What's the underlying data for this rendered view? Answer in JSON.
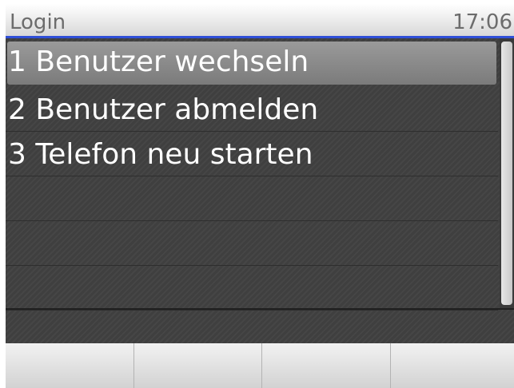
{
  "header": {
    "title": "Login",
    "time": "17:06"
  },
  "menu": {
    "items": [
      {
        "label": "1 Benutzer wechseln",
        "selected": true
      },
      {
        "label": "2 Benutzer abmelden",
        "selected": false
      },
      {
        "label": "3 Telefon neu starten",
        "selected": false
      }
    ]
  },
  "softkeys": [
    "",
    "",
    "",
    ""
  ],
  "colors": {
    "accent": "#2f4fd8",
    "background": "#3f3f3f",
    "selection": "#8a8a8a"
  }
}
